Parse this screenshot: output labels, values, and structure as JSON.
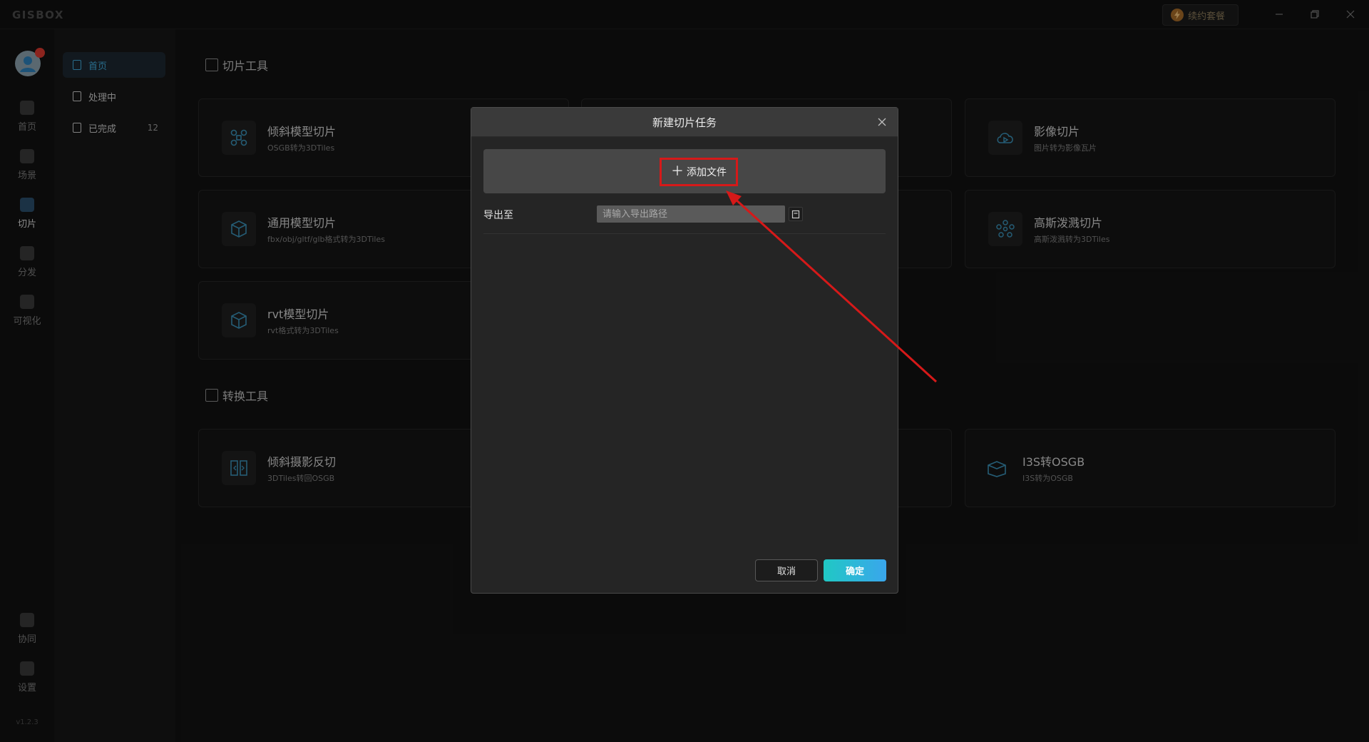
{
  "app": {
    "logo": "GISBOX",
    "package_label": "续约套餐",
    "version": "v1.2.3"
  },
  "rail": {
    "items": [
      {
        "label": "首页"
      },
      {
        "label": "场景"
      },
      {
        "label": "切片"
      },
      {
        "label": "分发"
      },
      {
        "label": "可视化"
      }
    ],
    "bottom_items": [
      {
        "label": "协同"
      },
      {
        "label": "设置"
      }
    ]
  },
  "subnav": {
    "items": [
      {
        "label": "首页",
        "count": ""
      },
      {
        "label": "处理中",
        "count": ""
      },
      {
        "label": "已完成",
        "count": "12"
      }
    ]
  },
  "main": {
    "slicing_title": "切片工具",
    "conversion_title": "转换工具",
    "cards": [
      {
        "title": "倾斜模型切片",
        "subtitle": "OSGB转为3DTiles",
        "icon": "drone-icon"
      },
      {
        "title": "影像切片",
        "subtitle": "图片转为影像瓦片",
        "icon": "cloud-play-icon"
      },
      {
        "title": "通用模型切片",
        "subtitle": "fbx/obj/gltf/glb格式转为3DTiles",
        "icon": "cube-icon"
      },
      {
        "title": "高斯泼溅切片",
        "subtitle": "高斯泼溅转为3DTiles",
        "icon": "dots-cluster-icon"
      },
      {
        "title": "rvt模型切片",
        "subtitle": "rvt格式转为3DTiles",
        "icon": "cube-icon"
      },
      {
        "title": "倾斜摄影反切",
        "subtitle": "3DTiles转回OSGB",
        "icon": "reverse-slice-icon"
      },
      {
        "title": "I3S转OSGB",
        "subtitle": "I3S转为OSGB",
        "icon": "box-open-icon"
      }
    ]
  },
  "dialog": {
    "title": "新建切片任务",
    "add_file_label": "添加文件",
    "export_label": "导出至",
    "export_placeholder": "请输入导出路径",
    "export_value": "",
    "cancel_label": "取消",
    "ok_label": "确定"
  },
  "colors": {
    "accent": "#3fa8d8",
    "ok_gradient_start": "#20c8c4",
    "ok_gradient_end": "#3aa6ec",
    "annotation_red": "#d61919"
  }
}
